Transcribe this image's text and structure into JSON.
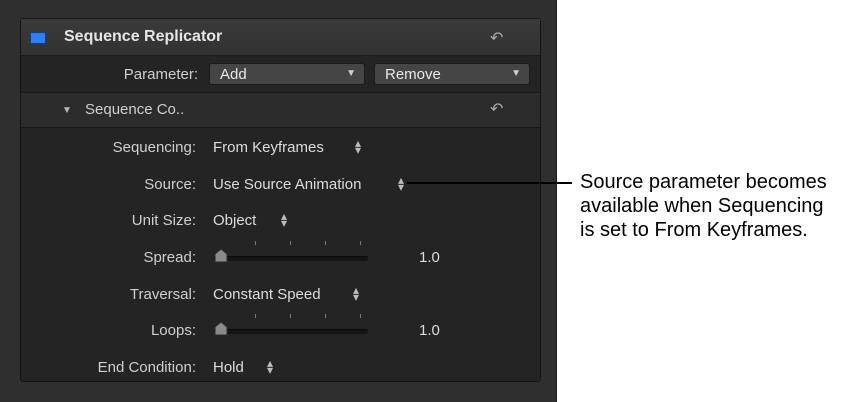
{
  "header": {
    "title": "Sequence Replicator"
  },
  "parameter": {
    "label": "Parameter:",
    "add": "Add",
    "remove": "Remove"
  },
  "group": {
    "title": "Sequence Co.."
  },
  "rows": {
    "sequencing": {
      "label": "Sequencing:",
      "value": "From Keyframes"
    },
    "source": {
      "label": "Source:",
      "value": "Use Source Animation"
    },
    "unit_size": {
      "label": "Unit Size:",
      "value": "Object"
    },
    "spread": {
      "label": "Spread:",
      "value": "1.0",
      "level": 0
    },
    "traversal": {
      "label": "Traversal:",
      "value": "Constant Speed"
    },
    "loops": {
      "label": "Loops:",
      "value": "1.0",
      "level": 0
    },
    "end_condition": {
      "label": "End Condition:",
      "value": "Hold"
    }
  },
  "callout": {
    "line1": "Source parameter becomes",
    "line2": "available when Sequencing",
    "line3": "is set to From Keyframes."
  },
  "icons": {
    "checkbox": "checkbox-checked-icon",
    "reset": "reset-arrow-icon",
    "disclosure": "triangle-down-icon",
    "stepper": "up-down-stepper-icon",
    "dropdown": "chevron-down-icon"
  },
  "colors": {
    "accent": "#2f7ff0",
    "panel": "#242424",
    "text": "#cfcfcf"
  }
}
